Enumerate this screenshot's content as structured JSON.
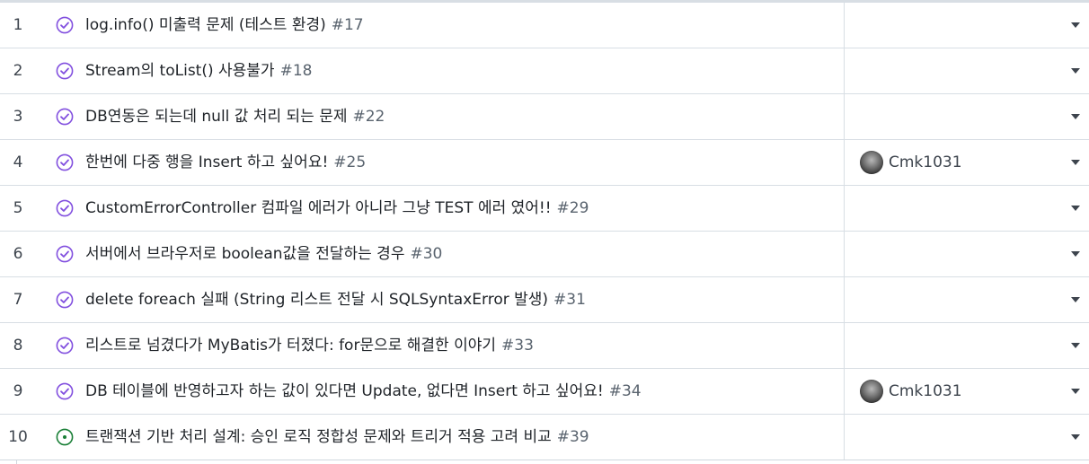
{
  "rows": [
    {
      "num": "1",
      "title": "log.info() 미출력 문제 (테스트 환경)",
      "issue": "#17",
      "status": "closed",
      "assignee": ""
    },
    {
      "num": "2",
      "title": "Stream의 toList() 사용불가",
      "issue": "#18",
      "status": "closed",
      "assignee": ""
    },
    {
      "num": "3",
      "title": "DB연동은 되는데 null 값 처리 되는 문제",
      "issue": "#22",
      "status": "closed",
      "assignee": ""
    },
    {
      "num": "4",
      "title": "한번에 다중 행을 Insert 하고 싶어요!",
      "issue": "#25",
      "status": "closed",
      "assignee": "Cmk1031"
    },
    {
      "num": "5",
      "title": "CustomErrorController 컴파일 에러가 아니라 그냥 TEST 에러 였어!!",
      "issue": "#29",
      "status": "closed",
      "assignee": ""
    },
    {
      "num": "6",
      "title": "서버에서 브라우저로 boolean값을 전달하는 경우",
      "issue": "#30",
      "status": "closed",
      "assignee": ""
    },
    {
      "num": "7",
      "title": "delete foreach 실패 (String 리스트 전달 시 SQLSyntaxError 발생)",
      "issue": "#31",
      "status": "closed",
      "assignee": ""
    },
    {
      "num": "8",
      "title": "리스트로 넘겼다가 MyBatis가 터졌다: for문으로 해결한 이야기",
      "issue": "#33",
      "status": "closed",
      "assignee": ""
    },
    {
      "num": "9",
      "title": "DB 테이블에 반영하고자 하는 값이 있다면 Update, 없다면 Insert 하고 싶어요!",
      "issue": "#34",
      "status": "closed",
      "assignee": "Cmk1031"
    },
    {
      "num": "10",
      "title": "트랜잭션 기반 처리 설계: 승인 로직 정합성 문제와 트리거 적용 고려 비교",
      "issue": "#39",
      "status": "open",
      "assignee": ""
    }
  ],
  "colors": {
    "closed": "#8250df",
    "open": "#1a7f37"
  },
  "icons": {
    "closed": "check-circle-icon",
    "open": "dot-circle-icon",
    "menu": "caret-down-icon"
  }
}
